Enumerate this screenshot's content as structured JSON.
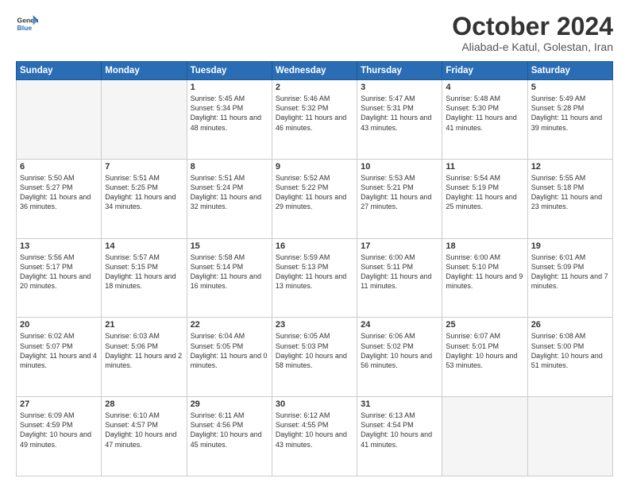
{
  "header": {
    "logo_line1": "General",
    "logo_line2": "Blue",
    "month": "October 2024",
    "location": "Aliabad-e Katul, Golestan, Iran"
  },
  "days_of_week": [
    "Sunday",
    "Monday",
    "Tuesday",
    "Wednesday",
    "Thursday",
    "Friday",
    "Saturday"
  ],
  "weeks": [
    [
      {
        "num": "",
        "info": ""
      },
      {
        "num": "",
        "info": ""
      },
      {
        "num": "1",
        "info": "Sunrise: 5:45 AM\nSunset: 5:34 PM\nDaylight: 11 hours and 48 minutes."
      },
      {
        "num": "2",
        "info": "Sunrise: 5:46 AM\nSunset: 5:32 PM\nDaylight: 11 hours and 46 minutes."
      },
      {
        "num": "3",
        "info": "Sunrise: 5:47 AM\nSunset: 5:31 PM\nDaylight: 11 hours and 43 minutes."
      },
      {
        "num": "4",
        "info": "Sunrise: 5:48 AM\nSunset: 5:30 PM\nDaylight: 11 hours and 41 minutes."
      },
      {
        "num": "5",
        "info": "Sunrise: 5:49 AM\nSunset: 5:28 PM\nDaylight: 11 hours and 39 minutes."
      }
    ],
    [
      {
        "num": "6",
        "info": "Sunrise: 5:50 AM\nSunset: 5:27 PM\nDaylight: 11 hours and 36 minutes."
      },
      {
        "num": "7",
        "info": "Sunrise: 5:51 AM\nSunset: 5:25 PM\nDaylight: 11 hours and 34 minutes."
      },
      {
        "num": "8",
        "info": "Sunrise: 5:51 AM\nSunset: 5:24 PM\nDaylight: 11 hours and 32 minutes."
      },
      {
        "num": "9",
        "info": "Sunrise: 5:52 AM\nSunset: 5:22 PM\nDaylight: 11 hours and 29 minutes."
      },
      {
        "num": "10",
        "info": "Sunrise: 5:53 AM\nSunset: 5:21 PM\nDaylight: 11 hours and 27 minutes."
      },
      {
        "num": "11",
        "info": "Sunrise: 5:54 AM\nSunset: 5:19 PM\nDaylight: 11 hours and 25 minutes."
      },
      {
        "num": "12",
        "info": "Sunrise: 5:55 AM\nSunset: 5:18 PM\nDaylight: 11 hours and 23 minutes."
      }
    ],
    [
      {
        "num": "13",
        "info": "Sunrise: 5:56 AM\nSunset: 5:17 PM\nDaylight: 11 hours and 20 minutes."
      },
      {
        "num": "14",
        "info": "Sunrise: 5:57 AM\nSunset: 5:15 PM\nDaylight: 11 hours and 18 minutes."
      },
      {
        "num": "15",
        "info": "Sunrise: 5:58 AM\nSunset: 5:14 PM\nDaylight: 11 hours and 16 minutes."
      },
      {
        "num": "16",
        "info": "Sunrise: 5:59 AM\nSunset: 5:13 PM\nDaylight: 11 hours and 13 minutes."
      },
      {
        "num": "17",
        "info": "Sunrise: 6:00 AM\nSunset: 5:11 PM\nDaylight: 11 hours and 11 minutes."
      },
      {
        "num": "18",
        "info": "Sunrise: 6:00 AM\nSunset: 5:10 PM\nDaylight: 11 hours and 9 minutes."
      },
      {
        "num": "19",
        "info": "Sunrise: 6:01 AM\nSunset: 5:09 PM\nDaylight: 11 hours and 7 minutes."
      }
    ],
    [
      {
        "num": "20",
        "info": "Sunrise: 6:02 AM\nSunset: 5:07 PM\nDaylight: 11 hours and 4 minutes."
      },
      {
        "num": "21",
        "info": "Sunrise: 6:03 AM\nSunset: 5:06 PM\nDaylight: 11 hours and 2 minutes."
      },
      {
        "num": "22",
        "info": "Sunrise: 6:04 AM\nSunset: 5:05 PM\nDaylight: 11 hours and 0 minutes."
      },
      {
        "num": "23",
        "info": "Sunrise: 6:05 AM\nSunset: 5:03 PM\nDaylight: 10 hours and 58 minutes."
      },
      {
        "num": "24",
        "info": "Sunrise: 6:06 AM\nSunset: 5:02 PM\nDaylight: 10 hours and 56 minutes."
      },
      {
        "num": "25",
        "info": "Sunrise: 6:07 AM\nSunset: 5:01 PM\nDaylight: 10 hours and 53 minutes."
      },
      {
        "num": "26",
        "info": "Sunrise: 6:08 AM\nSunset: 5:00 PM\nDaylight: 10 hours and 51 minutes."
      }
    ],
    [
      {
        "num": "27",
        "info": "Sunrise: 6:09 AM\nSunset: 4:59 PM\nDaylight: 10 hours and 49 minutes."
      },
      {
        "num": "28",
        "info": "Sunrise: 6:10 AM\nSunset: 4:57 PM\nDaylight: 10 hours and 47 minutes."
      },
      {
        "num": "29",
        "info": "Sunrise: 6:11 AM\nSunset: 4:56 PM\nDaylight: 10 hours and 45 minutes."
      },
      {
        "num": "30",
        "info": "Sunrise: 6:12 AM\nSunset: 4:55 PM\nDaylight: 10 hours and 43 minutes."
      },
      {
        "num": "31",
        "info": "Sunrise: 6:13 AM\nSunset: 4:54 PM\nDaylight: 10 hours and 41 minutes."
      },
      {
        "num": "",
        "info": ""
      },
      {
        "num": "",
        "info": ""
      }
    ]
  ]
}
